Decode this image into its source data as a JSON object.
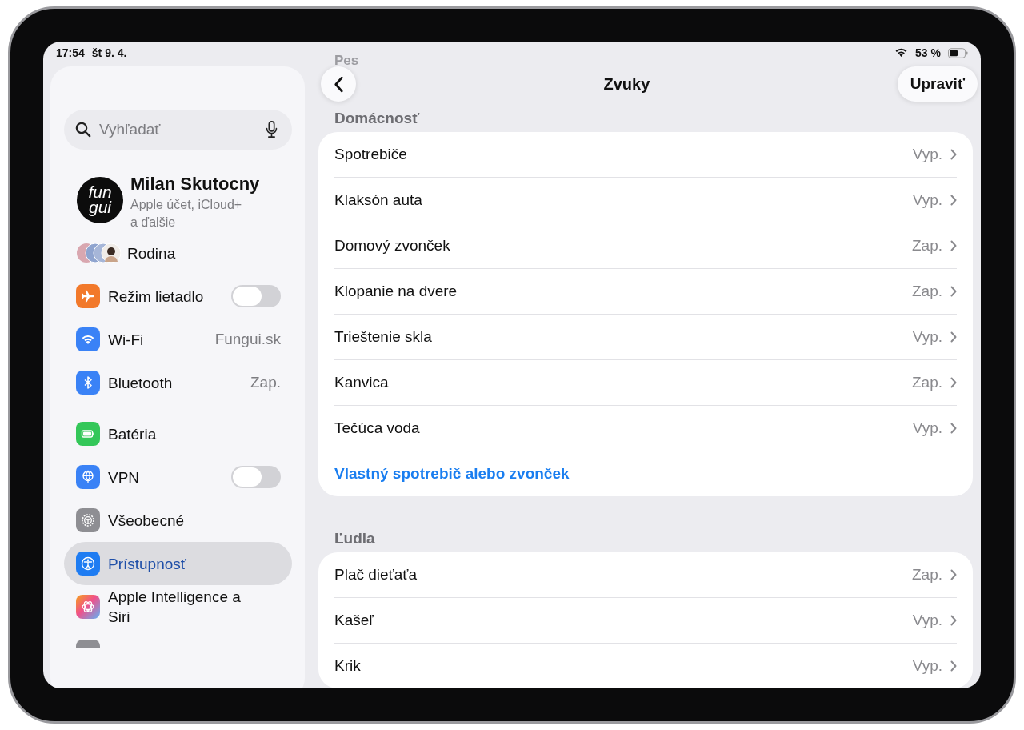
{
  "status_bar": {
    "time": "17:54",
    "date": "št 9. 4.",
    "battery": "53 %"
  },
  "sidebar": {
    "search": {
      "placeholder": "Vyhľadať"
    },
    "profile": {
      "avatar_text": [
        "fun",
        "gui"
      ],
      "name": "Milan Skutocny",
      "subtitle": "Apple účet, iCloud+ a ďalšie"
    },
    "items": [
      {
        "kind": "family",
        "label": "Rodina",
        "selected": false
      },
      {
        "kind": "toggle",
        "label": "Režim lietadlo",
        "on": false,
        "selected": false
      },
      {
        "kind": "value",
        "label": "Wi-Fi",
        "value": "Fungui.sk",
        "selected": false
      },
      {
        "kind": "value",
        "label": "Bluetooth",
        "value": "Zap.",
        "selected": false
      },
      {
        "kind": "link",
        "label": "Batéria",
        "selected": false
      },
      {
        "kind": "toggle",
        "label": "VPN",
        "on": false,
        "selected": false
      },
      {
        "kind": "link",
        "label": "Všeobecné",
        "selected": false
      },
      {
        "kind": "link",
        "label": "Prístupnosť",
        "selected": true
      },
      {
        "kind": "link",
        "label": "Apple Intelligence a Siri",
        "selected": false
      }
    ]
  },
  "main": {
    "scrolled_header": "Pes",
    "title": "Zvuky",
    "action": "Upraviť",
    "sections": [
      {
        "title": "Domácnosť",
        "rows": [
          {
            "label": "Spotrebiče",
            "value": "Vyp."
          },
          {
            "label": "Klaksón auta",
            "value": "Vyp."
          },
          {
            "label": "Domový zvonček",
            "value": "Zap."
          },
          {
            "label": "Klopanie na dvere",
            "value": "Zap."
          },
          {
            "label": "Trieštenie skla",
            "value": "Vyp."
          },
          {
            "label": "Kanvica",
            "value": "Zap."
          },
          {
            "label": "Tečúca voda",
            "value": "Vyp."
          }
        ],
        "link": "Vlastný spotrebič alebo zvonček"
      },
      {
        "title": "Ľudia",
        "rows": [
          {
            "label": "Plač dieťaťa",
            "value": "Zap."
          },
          {
            "label": "Kašeľ",
            "value": "Vyp."
          },
          {
            "label": "Krik",
            "value": "Vyp."
          }
        ]
      }
    ]
  }
}
